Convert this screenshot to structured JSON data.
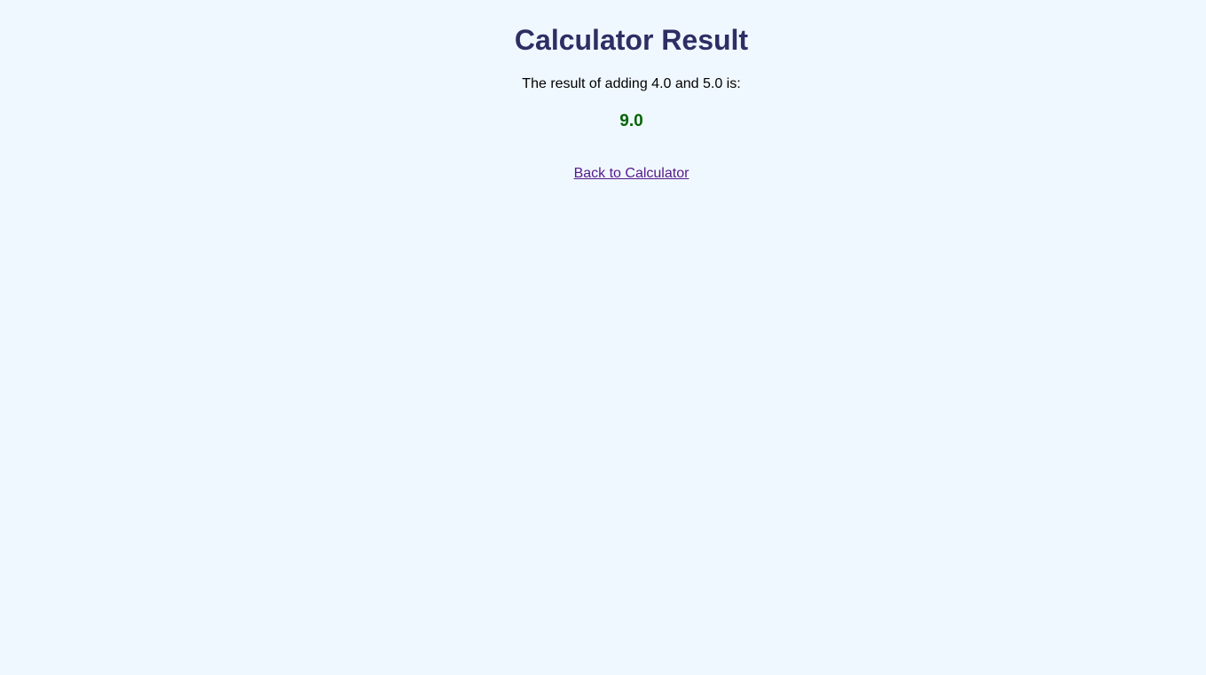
{
  "page": {
    "title": "Calculator Result",
    "description": "The result of adding 4.0 and 5.0 is:",
    "result": "9.0",
    "back_link": "Back to Calculator"
  },
  "colors": {
    "background": "#f0f8ff",
    "heading": "#2e2e64",
    "result": "#006400",
    "link": "#551a8b"
  }
}
